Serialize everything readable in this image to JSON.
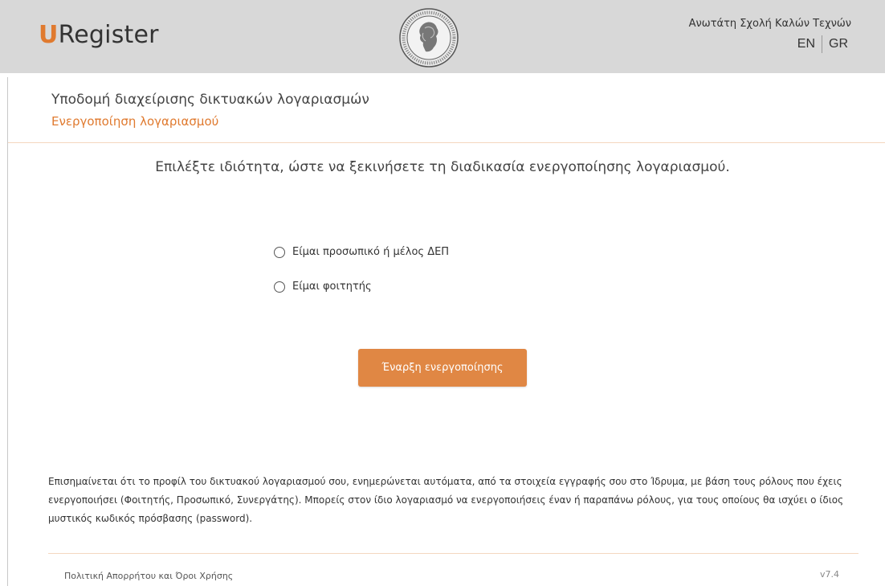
{
  "header": {
    "logo_u": "U",
    "logo_rest": "Register",
    "seal_icon": "university-seal-icon",
    "institution": "Ανωτάτη Σχολή Καλών Τεχνών",
    "lang_en": "EN",
    "lang_gr": "GR"
  },
  "page": {
    "title": "Υποδομή διαχείρισης δικτυακών λογαριασμών",
    "subtitle": "Ενεργοποίηση λογαριασμού",
    "prompt": "Επιλέξτε ιδιότητα, ώστε να ξεκινήσετε τη διαδικασία ενεργοποίησης λογαριασμού."
  },
  "options": [
    {
      "label": "Είμαι προσωπικό ή μέλος ΔΕΠ",
      "selected": false
    },
    {
      "label": "Είμαι φοιτητής",
      "selected": false
    }
  ],
  "actions": {
    "start_label": "Έναρξη ενεργοποίησης"
  },
  "notice": "Επισημαίνεται ότι το προφίλ του δικτυακού λογαριασμού σου, ενημερώνεται αυτόματα, από τα στοιχεία εγγραφής σου στο Ίδρυμα, με βάση τους ρόλους που έχεις ενεργοποιήσει (Φοιτητής, Προσωπικό, Συνεργάτης). Μπορείς στον ίδιο λογαριασμό να ενεργοποιήσεις έναν ή παραπάνω ρόλους, για τους οποίους θα ισχύει ο ίδιος μυστικός κωδικός πρόσβασης (password).",
  "footer": {
    "policy_link": "Πολιτική Απορρήτου και Όροι Χρήσης",
    "version": "v7.4"
  },
  "colors": {
    "accent": "#e07a2f",
    "button": "#e08744",
    "header_bg": "#d8d8d8"
  }
}
